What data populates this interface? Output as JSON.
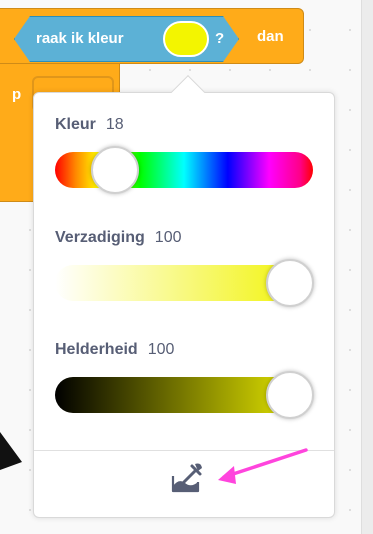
{
  "block": {
    "sensing_label": "raak ik kleur",
    "question_mark": "?",
    "then_label": "dan",
    "swatch_color": "#f3f500"
  },
  "color_picker": {
    "hue": {
      "label": "Kleur",
      "value": "18",
      "fraction": 0.18
    },
    "saturation": {
      "label": "Verzadiging",
      "value": "100",
      "fraction": 1.0
    },
    "brightness": {
      "label": "Helderheid",
      "value": "100",
      "fraction": 1.0
    },
    "eyedropper_icon": "eyedropper-icon"
  },
  "colors": {
    "sensing_blue": "#5cb1d6",
    "control_orange": "#ffab19",
    "annotation_pink": "#ff44dd",
    "text_gray": "#575e75"
  }
}
